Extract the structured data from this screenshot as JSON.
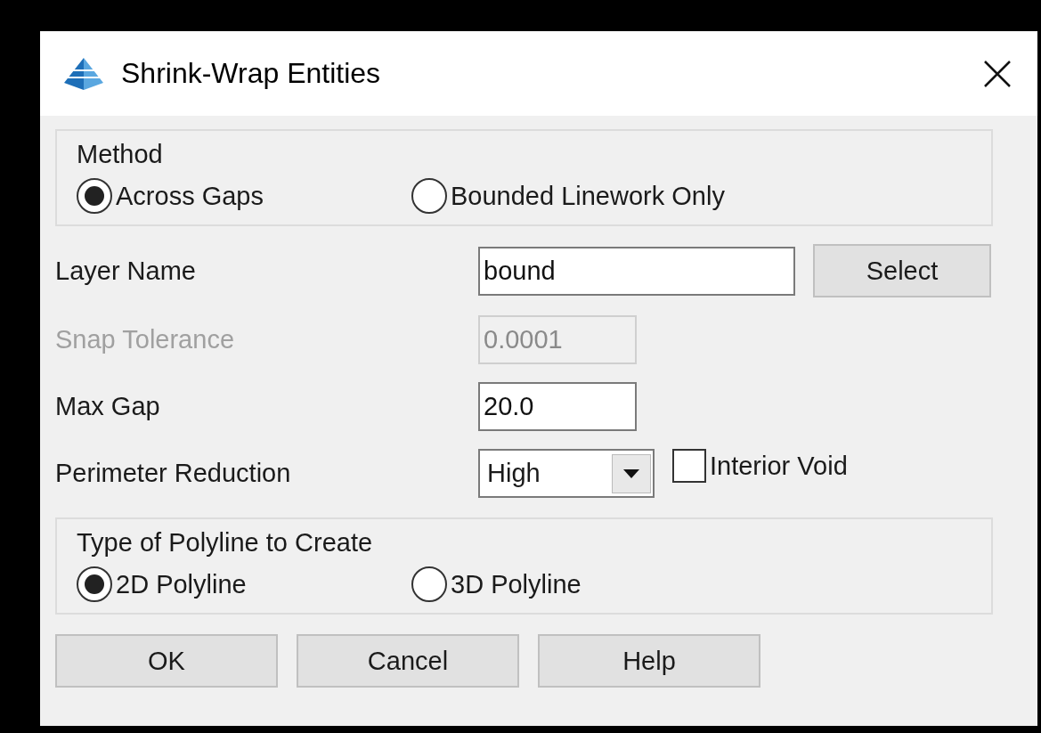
{
  "window": {
    "title": "Shrink-Wrap Entities"
  },
  "method": {
    "legend": "Method",
    "options": [
      {
        "label": "Across Gaps",
        "selected": true
      },
      {
        "label": "Bounded Linework Only",
        "selected": false
      }
    ]
  },
  "fields": [
    {
      "label": "Layer Name",
      "kind": "text",
      "value": "bound",
      "disabled": false,
      "button": "Select"
    },
    {
      "label": "Snap Tolerance",
      "kind": "text",
      "value": "0.0001",
      "disabled": true
    },
    {
      "label": "Max Gap",
      "kind": "text",
      "value": "20.0",
      "disabled": false
    },
    {
      "label": "Perimeter Reduction",
      "kind": "dropdown",
      "value": "High",
      "disabled": false,
      "checkbox": {
        "label": "Interior Void",
        "checked": false
      }
    }
  ],
  "polyline_type": {
    "legend": "Type of Polyline to Create",
    "options": [
      {
        "label": "2D Polyline",
        "selected": true
      },
      {
        "label": "3D Polyline",
        "selected": false
      }
    ]
  },
  "buttons": [
    "OK",
    "Cancel",
    "Help"
  ]
}
